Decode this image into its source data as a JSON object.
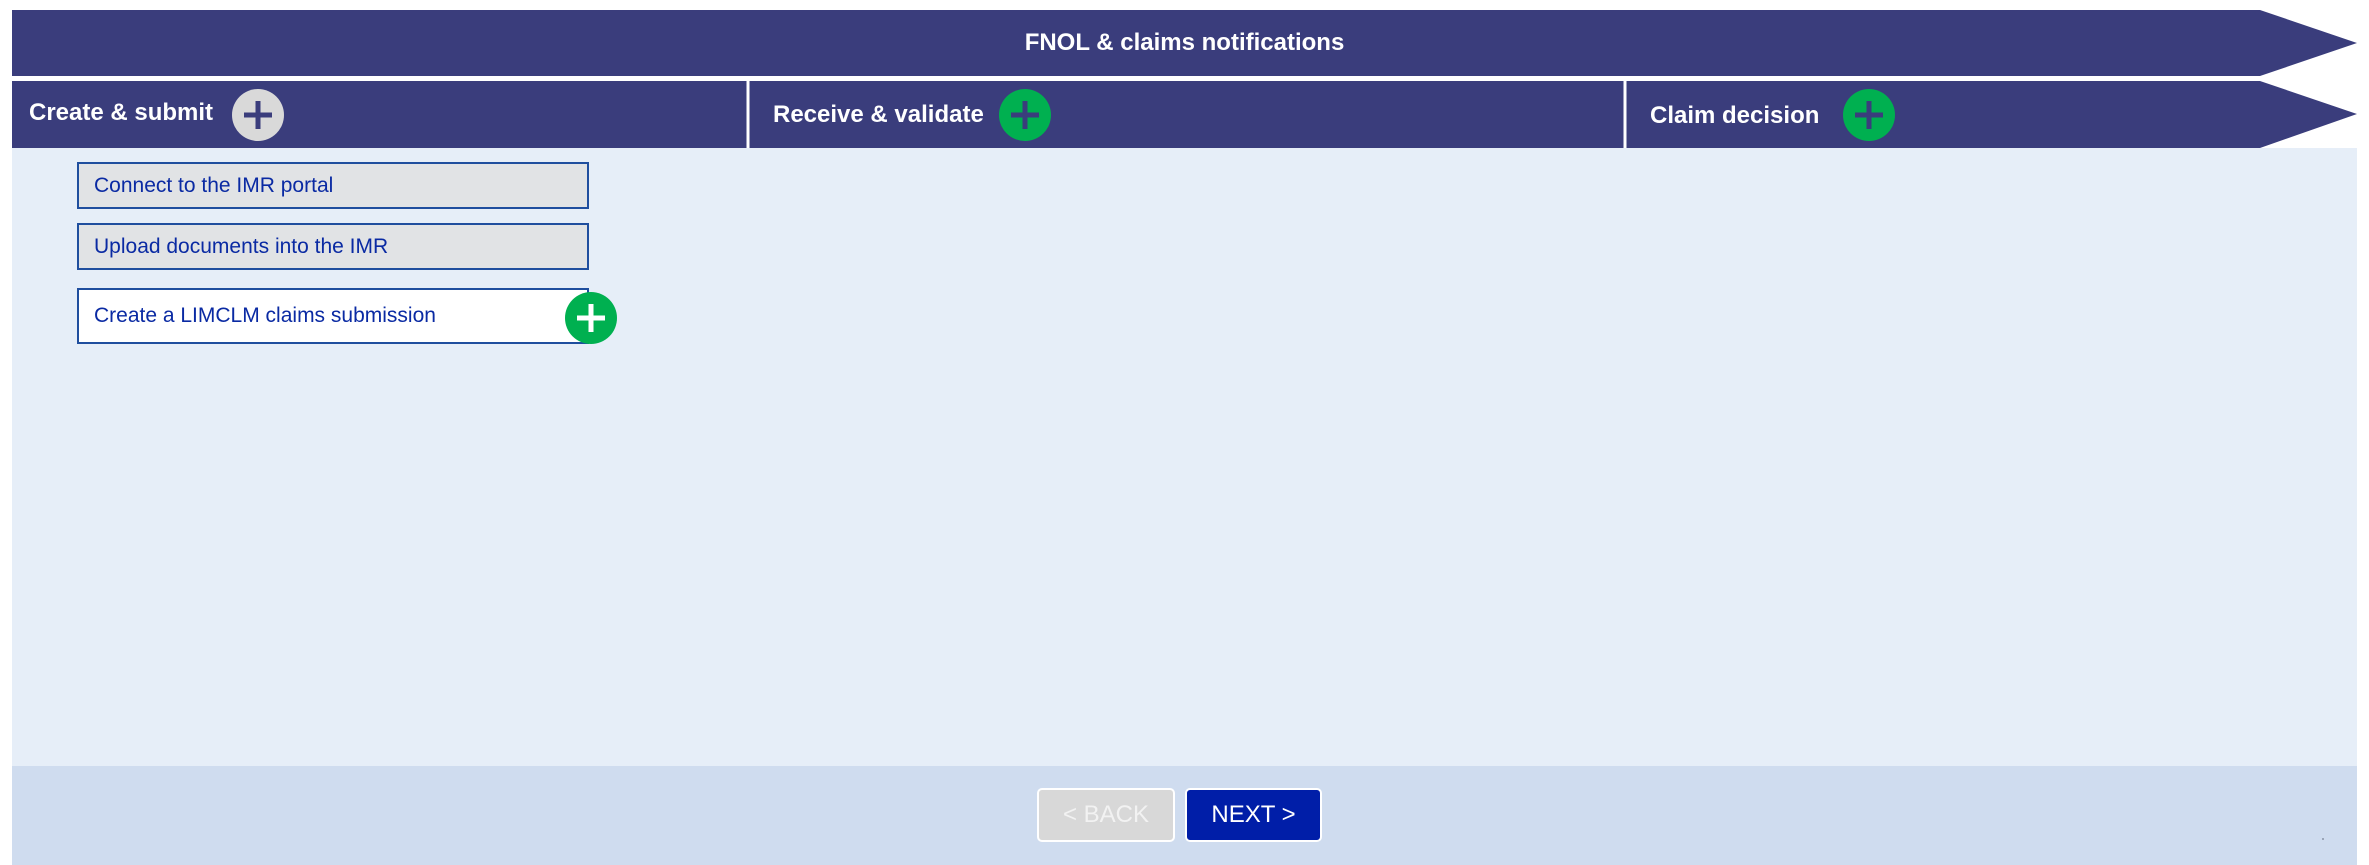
{
  "header": {
    "title": "FNOL & claims notifications"
  },
  "stages": [
    {
      "label": "Create & submit",
      "plus_icon": "plus-icon",
      "plus_state": "inactive"
    },
    {
      "label": "Receive & validate",
      "plus_icon": "plus-icon",
      "plus_state": "active"
    },
    {
      "label": "Claim decision",
      "plus_icon": "plus-icon",
      "plus_state": "active"
    }
  ],
  "tasks": [
    {
      "label": "Connect to the IMR portal"
    },
    {
      "label": "Upload documents into the IMR"
    },
    {
      "label": "Create a LIMCLM claims submission",
      "plus_icon": "plus-icon"
    }
  ],
  "navigation": {
    "back_label": "< BACK",
    "next_label": "NEXT >",
    "back_enabled": false
  },
  "colors": {
    "banner": "#3a3d7c",
    "content_bg": "#e6eef8",
    "footer_bg": "#cfdcef",
    "plus_active": "#00b050",
    "plus_inactive": "#d9d9d9",
    "task_text": "#0a2aa3",
    "task_border": "#1f4e9e",
    "next_button": "#001ea8",
    "back_button": "#d8d8d8"
  }
}
